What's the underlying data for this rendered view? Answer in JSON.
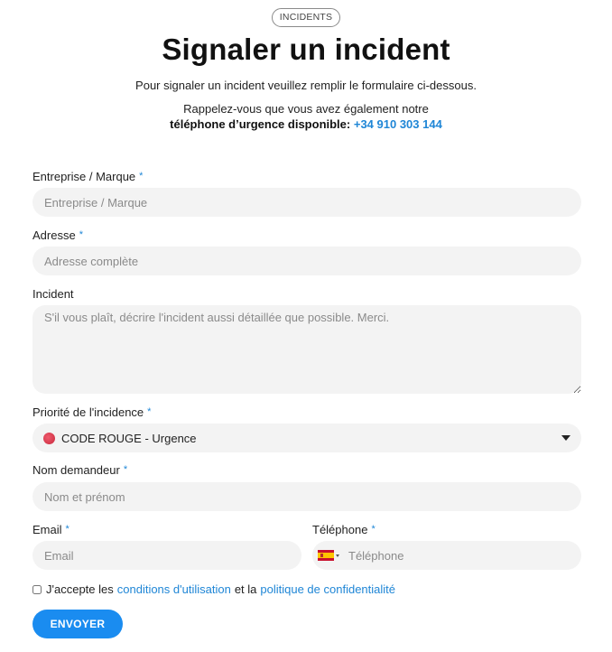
{
  "header": {
    "badge": "INCIDENTS",
    "title": "Signaler un incident",
    "intro": "Pour signaler un incident veuillez remplir le formulaire ci-dessous.",
    "reminder_line1": "Rappelez-vous que vous avez également notre",
    "reminder_bold": "téléphone d’urgence disponible:",
    "phone": "+34 910 303 144"
  },
  "form": {
    "company": {
      "label": "Entreprise / Marque",
      "required": "*",
      "placeholder": "Entreprise / Marque",
      "value": ""
    },
    "address": {
      "label": "Adresse",
      "required": "*",
      "placeholder": "Adresse complète",
      "value": ""
    },
    "incident": {
      "label": "Incident",
      "placeholder": "S'il vous plaît, décrire l'incident aussi détaillée que possible. Merci.",
      "value": ""
    },
    "priority": {
      "label": "Priorité de l'incidence",
      "required": "*",
      "selected": "CODE ROUGE - Urgence",
      "dot_color": "#d9344a"
    },
    "requester": {
      "label": "Nom demandeur",
      "required": "*",
      "placeholder": "Nom et prénom",
      "value": ""
    },
    "email": {
      "label": "Email",
      "required": "*",
      "placeholder": "Email",
      "value": ""
    },
    "phone": {
      "label": "Téléphone",
      "required": "*",
      "placeholder": "Téléphone",
      "value": "",
      "country_flag": "spain-flag-icon"
    },
    "terms": {
      "prefix": "J'accepte les",
      "conditions_link": "conditions d'utilisation",
      "middle": "et la",
      "privacy_link": "politique de confidentialité",
      "checked": false
    },
    "submit_label": "ENVOYER"
  },
  "colors": {
    "accent": "#1a8cf0",
    "field_bg": "#f3f3f3",
    "link": "#1f86d6"
  }
}
